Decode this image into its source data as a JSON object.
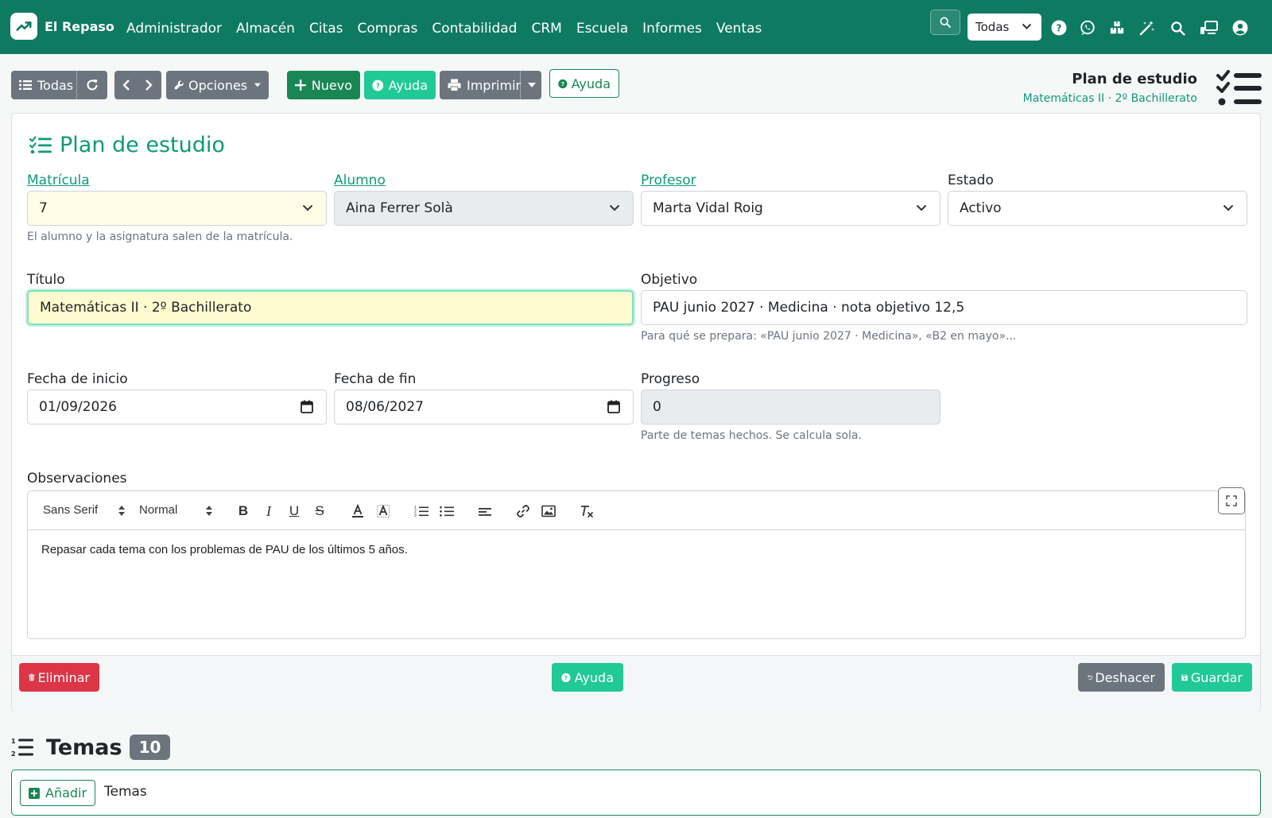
{
  "navbar": {
    "brand": "El Repaso",
    "menu": [
      "Administrador",
      "Almacén",
      "Citas",
      "Compras",
      "Contabilidad",
      "CRM",
      "Escuela",
      "Informes",
      "Ventas"
    ],
    "company_select": "Todas",
    "icons": [
      "search-icon",
      "help-icon",
      "whatsapp-icon",
      "boxes-icon",
      "magic-wand-icon",
      "search-icon",
      "screen-share-icon",
      "user-icon"
    ]
  },
  "toolbar": {
    "list_label": "Todas",
    "options_label": "Opciones",
    "new_label": "Nuevo",
    "help_label": "Ayuda",
    "print_label": "Imprimir",
    "help2_label": "Ayuda"
  },
  "page_header": {
    "title": "Plan de estudio",
    "subtitle": "Matemáticas II · 2º Bachillerato"
  },
  "form": {
    "title": "Plan de estudio",
    "matricula": {
      "label": "Matrícula",
      "value": "7",
      "help": "El alumno y la asignatura salen de la matrícula."
    },
    "alumno": {
      "label": "Alumno",
      "value": "Aina Ferrer Solà"
    },
    "profesor": {
      "label": "Profesor",
      "value": "Marta Vidal Roig"
    },
    "estado": {
      "label": "Estado",
      "value": "Activo"
    },
    "titulo": {
      "label": "Título",
      "value": "Matemáticas II · 2º Bachillerato"
    },
    "objetivo": {
      "label": "Objetivo",
      "value": "PAU junio 2027 · Medicina · nota objetivo 12,5",
      "help": "Para qué se prepara: «PAU junio 2027 · Medicina», «B2 en mayo»..."
    },
    "fecha_inicio": {
      "label": "Fecha de inicio",
      "value": "01/09/2026"
    },
    "fecha_fin": {
      "label": "Fecha de fin",
      "value": "08/06/2027"
    },
    "progreso": {
      "label": "Progreso",
      "value": "0",
      "help": "Parte de temas hechos. Se calcula sola."
    },
    "observaciones": {
      "label": "Observaciones",
      "font_select": "Sans Serif",
      "size_select": "Normal",
      "content": "Repasar cada tema con los problemas de PAU de los últimos 5 años."
    }
  },
  "footer": {
    "delete_label": "Eliminar",
    "help_label": "Ayuda",
    "undo_label": "Deshacer",
    "save_label": "Guardar"
  },
  "temas": {
    "title": "Temas",
    "count": "10",
    "add_label": "Añadir",
    "row_label": "Temas"
  },
  "colors": {
    "navbar": "#0e7a62",
    "accent": "#0e9a7a",
    "green": "#198754",
    "teal": "#20c997",
    "gray": "#6c757d",
    "danger": "#dc3545"
  }
}
